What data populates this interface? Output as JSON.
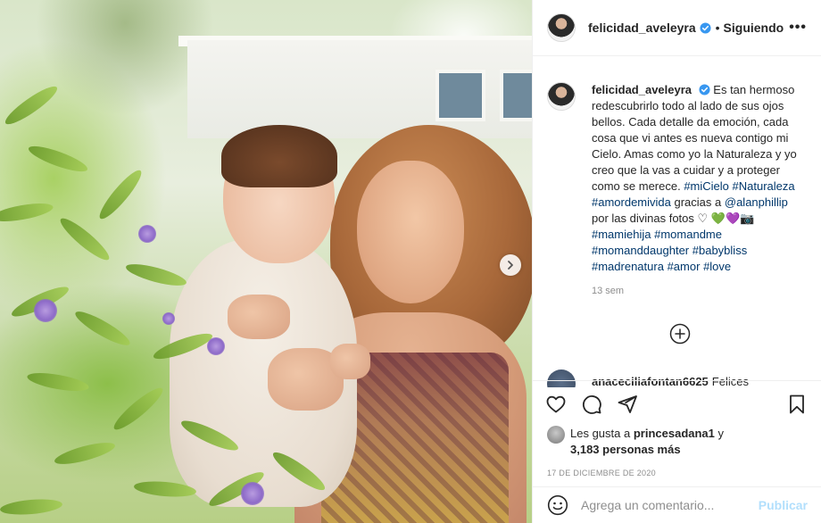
{
  "post": {
    "username": "felicidad_aveleyra",
    "follow_status": "Siguiendo",
    "separator": "•",
    "more_label": "•••"
  },
  "caption": {
    "username": "felicidad_aveleyra",
    "text_1": "Es tan hermoso redescubrirlo todo al lado de sus ojos bellos. Cada detalle da emoción, cada cosa que vi antes es nueva contigo mi Cielo. Amas como yo la Naturaleza y yo creo que la vas a cuidar y a proteger como se merece.",
    "tag_1": "#miCielo",
    "tag_2": "#Naturaleza",
    "tag_3": "#amordemivida",
    "text_2": "gracias a",
    "mention": "@alanphillip",
    "text_3": "por las divinas fotos",
    "heart_emoji": "♡",
    "emoji_green": "💚",
    "emoji_purple": "💜",
    "emoji_camera": "📷",
    "tag_4": "#mamiehija",
    "tag_5": "#momandme",
    "tag_6": "#momanddaughter",
    "tag_7": "#babybliss",
    "tag_8": "#madrenatura",
    "tag_9": "#amor",
    "tag_10": "#love",
    "time_ago": "13 sem"
  },
  "next_comment": {
    "username": "anaceciliafontan6625",
    "text": "Felices"
  },
  "likes": {
    "prefix": "Les gusta a",
    "user": "princesadana1",
    "conjunction": "y",
    "others": "3,183 personas más"
  },
  "date": "17 DE DICIEMBRE DE 2020",
  "add_comment": {
    "placeholder": "Agrega un comentario...",
    "publish_label": "Publicar"
  },
  "colors": {
    "verified": "#3897f0",
    "link": "#00376b",
    "publish_disabled": "#b2dffc",
    "secondary_text": "#8e8e8e"
  },
  "icons": [
    "verified-badge-icon",
    "more-options-icon",
    "chevron-right-icon",
    "plus-circle-icon",
    "heart-icon",
    "comment-icon",
    "share-icon",
    "bookmark-icon",
    "emoji-icon"
  ]
}
